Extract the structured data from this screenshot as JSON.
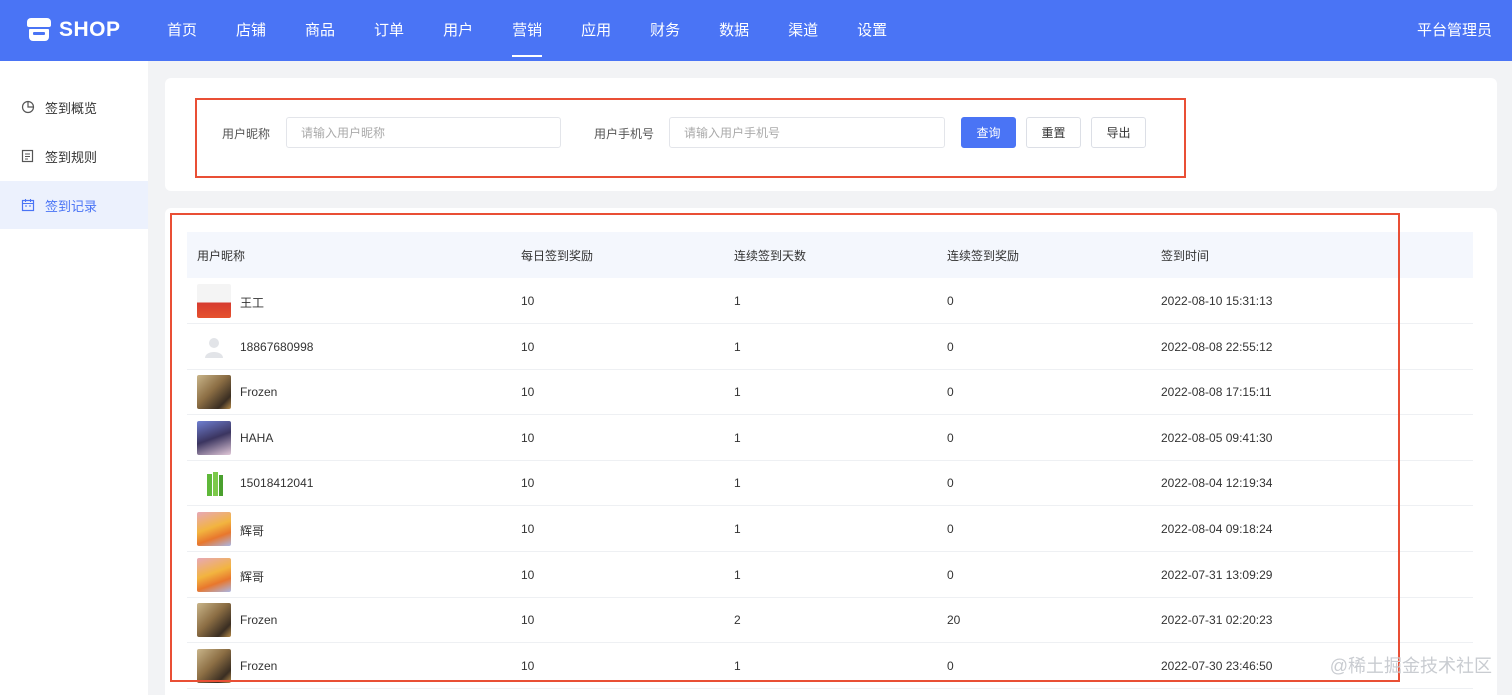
{
  "header": {
    "logo_text": "SHOP",
    "nav": [
      "首页",
      "店铺",
      "商品",
      "订单",
      "用户",
      "营销",
      "应用",
      "财务",
      "数据",
      "渠道",
      "设置"
    ],
    "active_nav": "营销",
    "admin_label": "平台管理员"
  },
  "sidebar": {
    "items": [
      {
        "label": "签到概览",
        "icon": "pie-chart-icon"
      },
      {
        "label": "签到规则",
        "icon": "rules-doc-icon"
      },
      {
        "label": "签到记录",
        "icon": "calendar-icon"
      }
    ],
    "active_index": 2
  },
  "search": {
    "nickname_label": "用户昵称",
    "nickname_placeholder": "请输入用户昵称",
    "phone_label": "用户手机号",
    "phone_placeholder": "请输入用户手机号",
    "query_button": "查询",
    "reset_button": "重置",
    "export_button": "导出"
  },
  "table": {
    "columns": [
      "用户昵称",
      "每日签到奖励",
      "连续签到天数",
      "连续签到奖励",
      "签到时间"
    ],
    "rows": [
      {
        "nickname": "王工",
        "daily_reward": "10",
        "streak_days": "1",
        "streak_reward": "0",
        "time": "2022-08-10 15:31:13",
        "avatar": "photo-avatar-icon"
      },
      {
        "nickname": "18867680998",
        "daily_reward": "10",
        "streak_days": "1",
        "streak_reward": "0",
        "time": "2022-08-08 22:55:12",
        "avatar": "default-user-avatar-icon"
      },
      {
        "nickname": "Frozen",
        "daily_reward": "10",
        "streak_days": "1",
        "streak_reward": "0",
        "time": "2022-08-08 17:15:11",
        "avatar": "photo-avatar-icon"
      },
      {
        "nickname": "HAHA",
        "daily_reward": "10",
        "streak_days": "1",
        "streak_reward": "0",
        "time": "2022-08-05 09:41:30",
        "avatar": "photo-avatar-icon"
      },
      {
        "nickname": "15018412041",
        "daily_reward": "10",
        "streak_days": "1",
        "streak_reward": "0",
        "time": "2022-08-04 12:19:34",
        "avatar": "photo-avatar-icon"
      },
      {
        "nickname": "辉哥",
        "daily_reward": "10",
        "streak_days": "1",
        "streak_reward": "0",
        "time": "2022-08-04 09:18:24",
        "avatar": "photo-avatar-icon"
      },
      {
        "nickname": "辉哥",
        "daily_reward": "10",
        "streak_days": "1",
        "streak_reward": "0",
        "time": "2022-07-31 13:09:29",
        "avatar": "photo-avatar-icon"
      },
      {
        "nickname": "Frozen",
        "daily_reward": "10",
        "streak_days": "2",
        "streak_reward": "20",
        "time": "2022-07-31 02:20:23",
        "avatar": "photo-avatar-icon"
      },
      {
        "nickname": "Frozen",
        "daily_reward": "10",
        "streak_days": "1",
        "streak_reward": "0",
        "time": "2022-07-30 23:46:50",
        "avatar": "photo-avatar-icon"
      }
    ]
  },
  "watermark": "@稀土掘金技术社区",
  "colors": {
    "brand": "#4a74f5",
    "highlight_box": "#e94f35",
    "sidebar_active_bg": "#ecf1fd"
  }
}
